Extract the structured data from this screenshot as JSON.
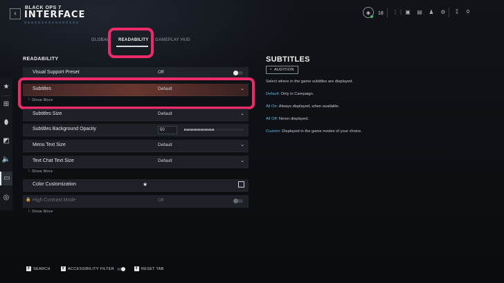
{
  "header": {
    "brand_small": "BLACK OPS 7",
    "brand_title": "INTERFACE",
    "back_glyph": "‹",
    "cod_points": "18",
    "friends_count": "0"
  },
  "tabs": [
    {
      "label": "GLOBAL",
      "active": false
    },
    {
      "label": "READABILITY",
      "active": true
    },
    {
      "label": "GAMEPLAY HUD",
      "active": false
    }
  ],
  "section_title": "READABILITY",
  "settings": [
    {
      "label": "Visual Support Preset",
      "value": "Off",
      "control": "toggle"
    },
    {
      "label": "Subtitles",
      "value": "Default",
      "control": "dropdown",
      "selected": true
    },
    {
      "label": "Subtitles Size",
      "value": "Default",
      "control": "dropdown"
    },
    {
      "label": "Subtitles Background Opacity",
      "value": "50",
      "control": "slider",
      "level": 0.5
    },
    {
      "label": "Menu Text Size",
      "value": "Default",
      "control": "dropdown"
    },
    {
      "label": "Text Chat Text Size",
      "value": "Default",
      "control": "dropdown"
    },
    {
      "label": "Color Customization",
      "value": "★",
      "control": "external"
    },
    {
      "label": "High Contrast Mode",
      "value": "Off",
      "control": "toggle",
      "disabled": true
    }
  ],
  "show_more_label": "Show More",
  "detail": {
    "title": "SUBTITLES",
    "audition_label": "AUDITION",
    "description": "Select where in the game subtitles are displayed.",
    "options": [
      {
        "key": "Default:",
        "text": " Only in Campaign."
      },
      {
        "key": "All On:",
        "text": " Always displayed, when available."
      },
      {
        "key": "All Off:",
        "text": " Never displayed."
      },
      {
        "key": "Custom:",
        "text": " Displayed in the game modes of your choice."
      }
    ]
  },
  "footer": {
    "search_label": "SEARCH",
    "accessibility_filter_label": "ACCESSIBILITY FILTER",
    "reset_tab_label": "RESET TAB"
  },
  "colors": {
    "highlight": "#ef2a6a",
    "accent_text": "#5fb6e8",
    "online": "#35c05a"
  }
}
